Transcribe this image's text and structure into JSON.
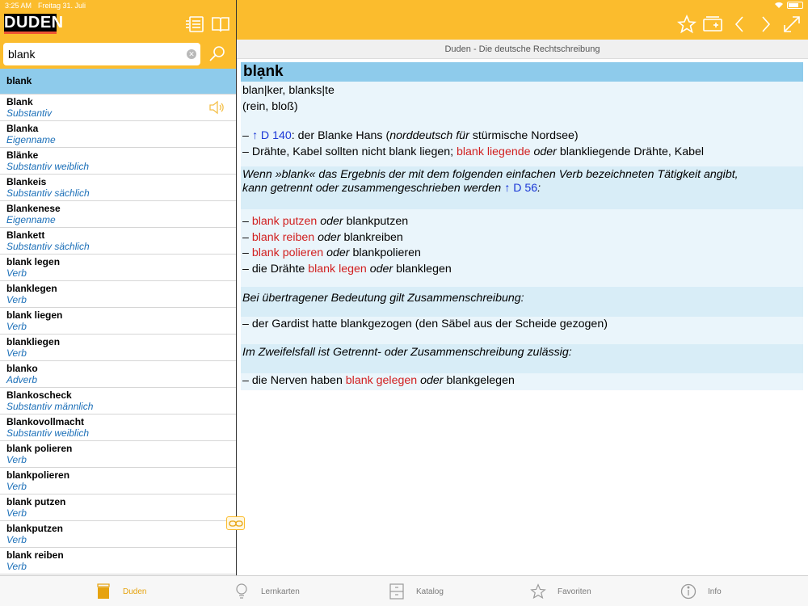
{
  "status": {
    "time": "3:25 AM",
    "date": "Freitag 31. Juli"
  },
  "header": {
    "logo": "DUDEN"
  },
  "search": {
    "value": "blank",
    "placeholder": ""
  },
  "results": {
    "selected": "blank",
    "items": [
      {
        "word": "Blank",
        "type": "Substantiv"
      },
      {
        "word": "Blanka",
        "type": "Eigenname"
      },
      {
        "word": "Blänke",
        "type": "Substantiv weiblich"
      },
      {
        "word": "Blankeis",
        "type": "Substantiv sächlich"
      },
      {
        "word": "Blankenese",
        "type": "Eigenname"
      },
      {
        "word": "Blankett",
        "type": "Substantiv sächlich"
      },
      {
        "word": "blank legen",
        "type": "Verb"
      },
      {
        "word": "blanklegen",
        "type": "Verb"
      },
      {
        "word": "blank liegen",
        "type": "Verb"
      },
      {
        "word": "blankliegen",
        "type": "Verb"
      },
      {
        "word": "blanko",
        "type": "Adverb"
      },
      {
        "word": "Blankoscheck",
        "type": "Substantiv männlich"
      },
      {
        "word": "Blankovollmacht",
        "type": "Substantiv weiblich"
      },
      {
        "word": "blank polieren",
        "type": "Verb"
      },
      {
        "word": "blankpolieren",
        "type": "Verb"
      },
      {
        "word": "blank putzen",
        "type": "Verb"
      },
      {
        "word": "blankputzen",
        "type": "Verb"
      },
      {
        "word": "blank reiben",
        "type": "Verb"
      }
    ]
  },
  "content": {
    "title": "Duden - Die deutsche Rechtschreibung",
    "headword": "blạnk",
    "forms": "blan|ker, blanks|te",
    "meaning": "(rein, bloß)",
    "ex1": {
      "dash": "– ",
      "ref": "↑ D 140",
      "text1": ": der Blanke Hans (",
      "italic": "norddeutsch für",
      "text2": " stürmische Nordsee)"
    },
    "ex2": {
      "text1": "– Drähte, Kabel sollten nicht blank liegen; ",
      "red": "blank liegende",
      "oder": "oder",
      "text2": " blankliegende Drähte, Kabel"
    },
    "note1": {
      "line1": "Wenn »blank« das Ergebnis der mit dem folgenden einfachen Verb bezeichneten Tätigkeit angibt,",
      "line2": "kann getrennt oder zusammengeschrieben werden ",
      "ref": "↑ D 56",
      "colon": ":"
    },
    "verbs": [
      {
        "prefix": "– ",
        "red": "blank putzen",
        "oder": "oder",
        "rest": " blankputzen"
      },
      {
        "prefix": "– ",
        "red": "blank reiben",
        "oder": "oder",
        "rest": " blankreiben"
      },
      {
        "prefix": "– ",
        "red": "blank polieren",
        "oder": "oder",
        "rest": " blankpolieren"
      },
      {
        "prefix": "– die Drähte ",
        "red": "blank legen",
        "oder": "oder",
        "rest": " blanklegen"
      }
    ],
    "note2": "Bei übertragener Bedeutung gilt Zusammenschreibung:",
    "ex3": "– der Gardist hatte blankgezogen (den Säbel aus der Scheide gezogen)",
    "note3": "Im Zweifelsfall ist Getrennt- oder Zusammenschreibung zulässig:",
    "ex4": {
      "prefix": "– die Nerven haben ",
      "red": "blank gelegen",
      "oder": "oder",
      "rest": " blankgelegen"
    }
  },
  "tabs": [
    {
      "label": "Duden",
      "icon": "duden-tab-icon",
      "active": true
    },
    {
      "label": "Lernkarten",
      "icon": "lightbulb-icon",
      "active": false
    },
    {
      "label": "Katalog",
      "icon": "catalog-icon",
      "active": false
    },
    {
      "label": "Favoriten",
      "icon": "star-icon",
      "active": false
    },
    {
      "label": "Info",
      "icon": "info-icon",
      "active": false
    }
  ],
  "colors": {
    "accent": "#FBBC2D",
    "selection": "#8ECBEB",
    "type_text": "#1b6fb8",
    "highlight_red": "#D11F1F",
    "ref_blue": "#1a37d6"
  }
}
